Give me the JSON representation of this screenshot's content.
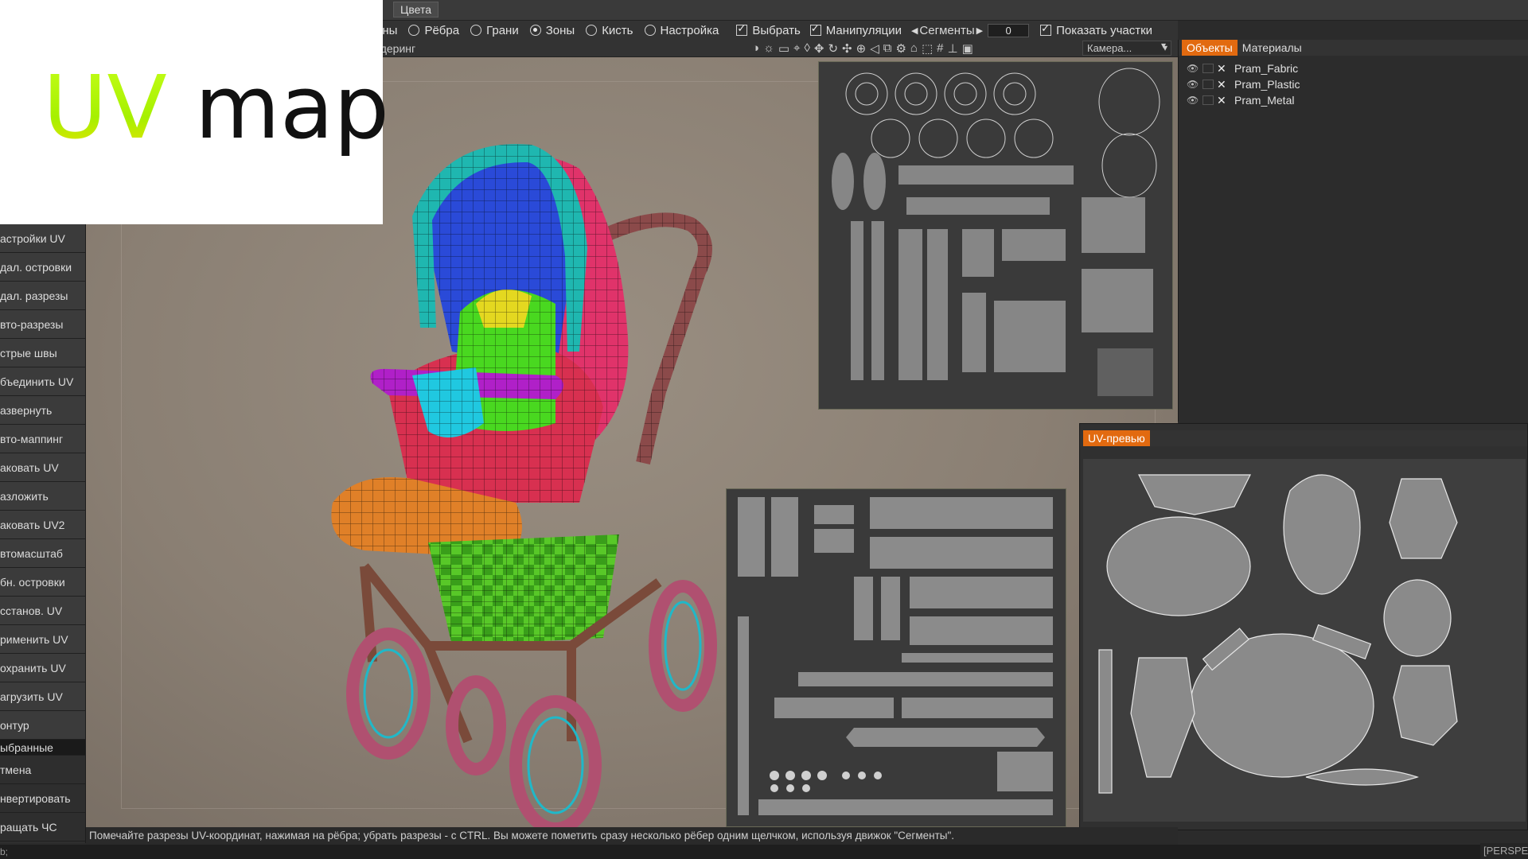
{
  "logo": {
    "uv": "UV",
    "map": "map"
  },
  "toolbar": {
    "colors_tab": "Цвета",
    "modes": [
      {
        "label": "ины",
        "checked": false
      },
      {
        "label": "Рёбра",
        "checked": false
      },
      {
        "label": "Грани",
        "checked": false
      },
      {
        "label": "Зоны",
        "checked": true
      },
      {
        "label": "Кисть",
        "checked": false
      },
      {
        "label": "Настройка",
        "checked": false
      }
    ],
    "select_label": "Выбрать",
    "manip_label": "Манипуляции",
    "segments_label": "Сегменты",
    "segments_value": "0",
    "show_areas_label": "Показать участки",
    "render_label": "ндеринг",
    "camera_label": "Камера..."
  },
  "left_panel": {
    "items": [
      "астройки UV",
      "дал. островки",
      "дал. разрезы",
      "вто-разрезы",
      "стрые швы",
      "бъединить UV",
      "азвернуть",
      "вто-маппинг",
      "аковать UV",
      "азложить",
      "аковать UV2",
      "втомасштаб",
      "бн. островки",
      "сстанов. UV",
      "рименить UV",
      "охранить UV",
      "агрузить UV",
      "онтур"
    ],
    "selected": "ыбранные",
    "items_after": [
      "тмена",
      "нвертировать",
      "ращать ЧС"
    ]
  },
  "objects_panel": {
    "tab_objects": "Объекты",
    "tab_materials": "Материалы",
    "objects": [
      "Pram_Fabric",
      "Pram_Plastic",
      "Pram_Metal"
    ]
  },
  "uv_preview": {
    "tab": "UV-превью"
  },
  "status": {
    "hint": "Помечайте разрезы UV-координат, нажимая на рёбра; убрать разрезы - с CTRL. Вы можете пометить сразу несколько рёбер одним щелчком, используя движок \"Сегменты\".",
    "viewport_mode": "[PERSPE",
    "bottom_left": "b;"
  },
  "colors": {
    "accent": "#e26a10",
    "background": "#2b2b2b"
  }
}
